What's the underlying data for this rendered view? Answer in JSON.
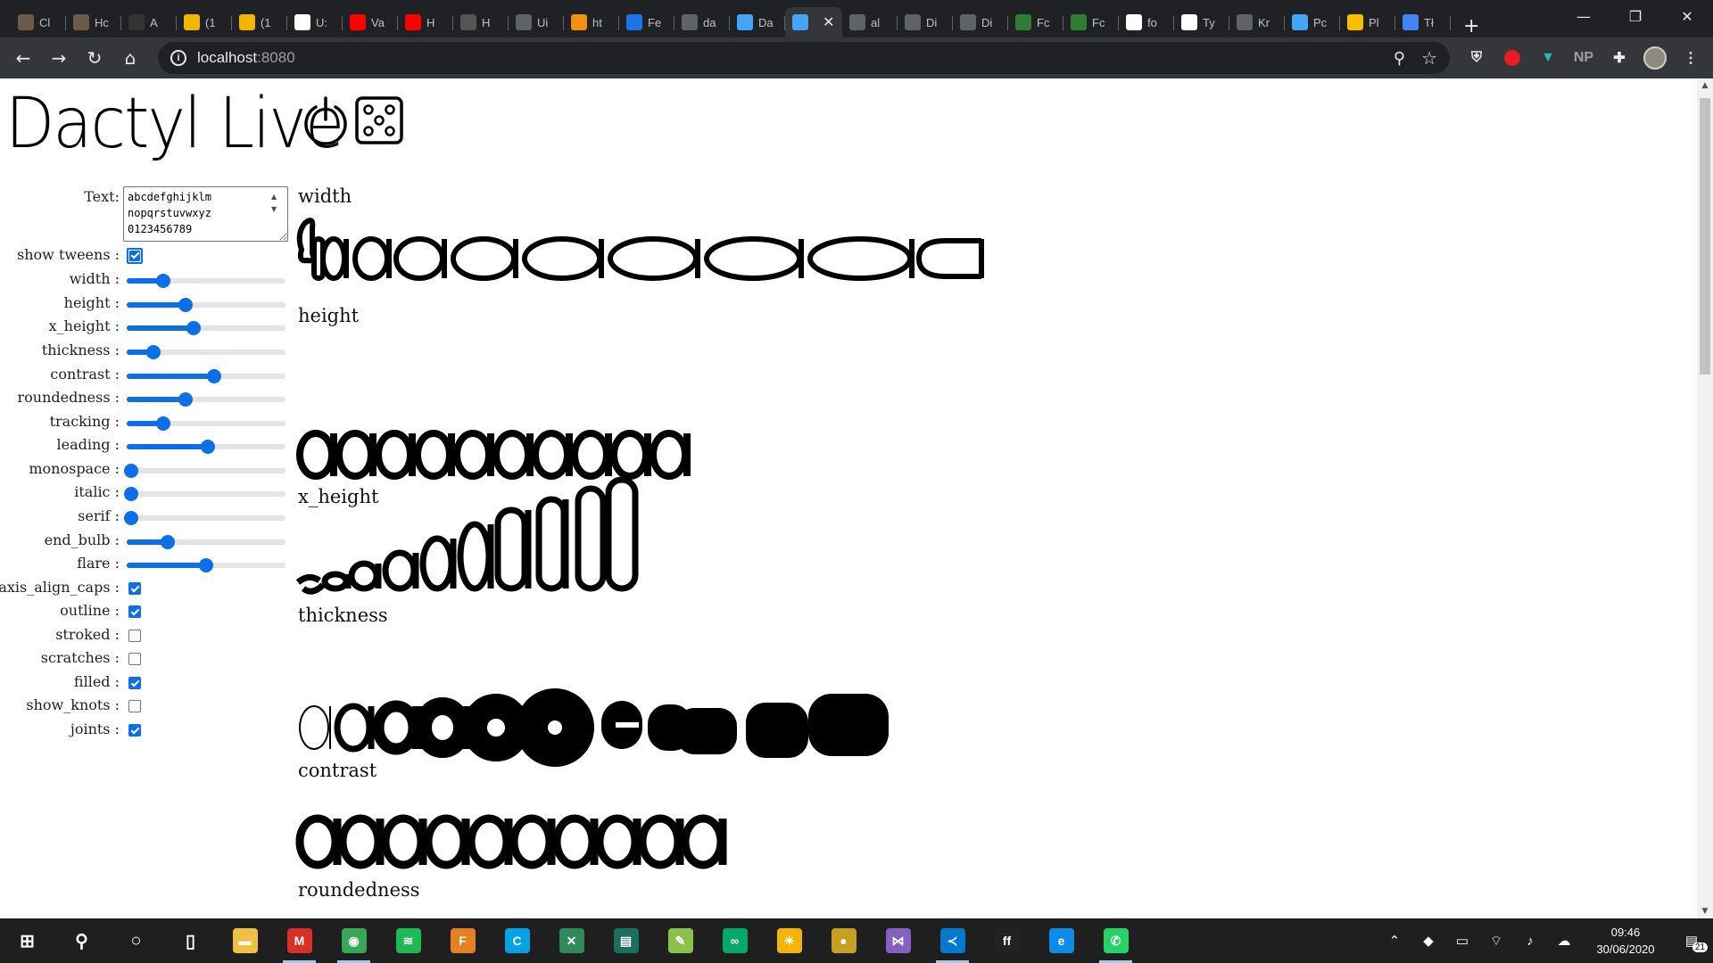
{
  "browser": {
    "tabs": [
      {
        "label": "Cl",
        "icon": "image-favicon",
        "color": "#6b5a4a"
      },
      {
        "label": "Hc",
        "icon": "image-favicon",
        "color": "#6b5a4a"
      },
      {
        "label": "A",
        "icon": "github-icon",
        "color": "#333333"
      },
      {
        "label": "(1",
        "icon": "g-favicon",
        "color": "#f2b600"
      },
      {
        "label": "(1",
        "icon": "g-favicon",
        "color": "#f2b600"
      },
      {
        "label": "U:",
        "icon": "qr-favicon",
        "color": "#ffffff"
      },
      {
        "label": "Va",
        "icon": "youtube-icon",
        "color": "#ff0000"
      },
      {
        "label": "H",
        "icon": "youtube-icon",
        "color": "#ff0000"
      },
      {
        "label": "H",
        "icon": "dots-favicon",
        "color": "#555555"
      },
      {
        "label": "Ui",
        "icon": "globe-icon",
        "color": "#5f6368"
      },
      {
        "label": "ht",
        "icon": "s-favicon",
        "color": "#f29111"
      },
      {
        "label": "Fe",
        "icon": "gd-favicon",
        "color": "#1a73e8"
      },
      {
        "label": "da",
        "icon": "globe-icon",
        "color": "#5f6368"
      },
      {
        "label": "Da",
        "icon": "flutter-icon",
        "color": "#42a5f5"
      },
      {
        "label": "",
        "icon": "flutter-icon",
        "color": "#42a5f5"
      },
      {
        "label": "al",
        "icon": "globe-icon",
        "color": "#5f6368"
      },
      {
        "label": "Di",
        "icon": "globe-icon",
        "color": "#5f6368"
      },
      {
        "label": "Di",
        "icon": "globe-icon",
        "color": "#5f6368"
      },
      {
        "label": "Fc",
        "icon": "ampersand-icon",
        "color": "#2e7d32"
      },
      {
        "label": "Fc",
        "icon": "ampersand-icon",
        "color": "#2e7d32"
      },
      {
        "label": "fo",
        "icon": "google-icon",
        "color": "#ffffff"
      },
      {
        "label": "Ty",
        "icon": "doc-favicon",
        "color": "#ffffff"
      },
      {
        "label": "Kr",
        "icon": "globe-icon",
        "color": "#5f6368"
      },
      {
        "label": "Pc",
        "icon": "flutter-icon",
        "color": "#42a5f5"
      },
      {
        "label": "Pl",
        "icon": "pinwheel-icon",
        "color": "#fbbc04"
      },
      {
        "label": "Tł",
        "icon": "docs-icon",
        "color": "#4285f4"
      }
    ],
    "active_tab_index": 14,
    "new_tab": "+",
    "window_controls": {
      "minimize": "—",
      "maximize": "❐",
      "close": "✕"
    },
    "url_host": "localhost",
    "url_port": ":8080",
    "extensions": [
      "shield-icon",
      "adblock-icon",
      "tshirt-icon",
      "NP",
      "puzzle-icon",
      "avatar",
      "menu-icon"
    ]
  },
  "page": {
    "title": "Dactyl Live",
    "text_label": "Text:",
    "text_value": "abcdefghijklm\nnopqrstuvwxyz\n0123456789",
    "show_tweens_label": "show tweens :",
    "controls": [
      {
        "label": "width :",
        "type": "slider",
        "value": 0.23
      },
      {
        "label": "height :",
        "type": "slider",
        "value": 0.37
      },
      {
        "label": "x_height :",
        "type": "slider",
        "value": 0.42
      },
      {
        "label": "thickness :",
        "type": "slider",
        "value": 0.17
      },
      {
        "label": "contrast :",
        "type": "slider",
        "value": 0.55
      },
      {
        "label": "roundedness :",
        "type": "slider",
        "value": 0.37
      },
      {
        "label": "tracking :",
        "type": "slider",
        "value": 0.23
      },
      {
        "label": "leading :",
        "type": "slider",
        "value": 0.51
      },
      {
        "label": "monospace :",
        "type": "slider",
        "value": 0.03
      },
      {
        "label": "italic :",
        "type": "slider",
        "value": 0.03
      },
      {
        "label": "serif :",
        "type": "slider",
        "value": 0.03
      },
      {
        "label": "end_bulb :",
        "type": "slider",
        "value": 0.26
      },
      {
        "label": "flare :",
        "type": "slider",
        "value": 0.5
      },
      {
        "label": "axis_align_caps :",
        "type": "checkbox",
        "checked": true
      },
      {
        "label": "outline :",
        "type": "checkbox",
        "checked": true
      },
      {
        "label": "stroked :",
        "type": "checkbox",
        "checked": false
      },
      {
        "label": "scratches :",
        "type": "checkbox",
        "checked": false
      },
      {
        "label": "filled :",
        "type": "checkbox",
        "checked": true
      },
      {
        "label": "show_knots :",
        "type": "checkbox",
        "checked": false
      },
      {
        "label": "joints :",
        "type": "checkbox",
        "checked": true
      }
    ],
    "previews": [
      {
        "label": "width"
      },
      {
        "label": "height"
      },
      {
        "label": "x_height"
      },
      {
        "label": "thickness"
      },
      {
        "label": "contrast"
      },
      {
        "label": "roundedness"
      }
    ]
  },
  "taskbar": {
    "apps": [
      {
        "name": "windows-start",
        "glyph": "⊞",
        "color": "transparent"
      },
      {
        "name": "search-icon",
        "glyph": "⚲",
        "color": "transparent"
      },
      {
        "name": "cortana-icon",
        "glyph": "○",
        "color": "transparent"
      },
      {
        "name": "task-view-icon",
        "glyph": "▯",
        "color": "transparent"
      },
      {
        "name": "file-explorer-icon",
        "glyph": "▬",
        "color": "#f0c040"
      },
      {
        "name": "gmail-icon",
        "glyph": "M",
        "color": "#d93025"
      },
      {
        "name": "chrome-icon",
        "glyph": "◉",
        "color": "#34a853"
      },
      {
        "name": "spotify-icon",
        "glyph": "≋",
        "color": "#1db954"
      },
      {
        "name": "fusion-icon",
        "glyph": "F",
        "color": "#e67e22"
      },
      {
        "name": "c-app-icon",
        "glyph": "C",
        "color": "#00a4e4"
      },
      {
        "name": "x-app-icon",
        "glyph": "✕",
        "color": "#2e8b57"
      },
      {
        "name": "terminal-icon",
        "glyph": "▤",
        "color": "#1b6f5f"
      },
      {
        "name": "notepad-icon",
        "glyph": "✎",
        "color": "#8bc34a"
      },
      {
        "name": "infinity-icon",
        "glyph": "∞",
        "color": "#00a86b"
      },
      {
        "name": "bulb-icon",
        "glyph": "☀",
        "color": "#f4b400"
      },
      {
        "name": "globe-app-icon",
        "glyph": "●",
        "color": "#c8a020"
      },
      {
        "name": "visual-studio-icon",
        "glyph": "⋈",
        "color": "#865fc5"
      },
      {
        "name": "vscode-icon",
        "glyph": "≺",
        "color": "#007acc"
      },
      {
        "name": "fontforge-icon",
        "glyph": "ff",
        "color": "#222222"
      },
      {
        "name": "edge-icon",
        "glyph": "e",
        "color": "#0c8ce9"
      },
      {
        "name": "whatsapp-icon",
        "glyph": "✆",
        "color": "#25d366"
      }
    ],
    "time": "09:46",
    "date": "30/06/2020",
    "notification_count": "21"
  }
}
